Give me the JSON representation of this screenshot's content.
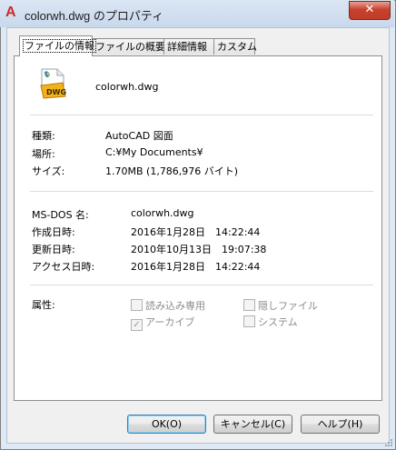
{
  "window": {
    "title": "colorwh.dwg のプロパティ",
    "close_glyph": "✕",
    "app_icon_letter": "A"
  },
  "tabs": [
    {
      "label": "ファイルの情報"
    },
    {
      "label": "ファイルの概要"
    },
    {
      "label": "詳細情報"
    },
    {
      "label": "カスタム"
    }
  ],
  "file": {
    "name": "colorwh.dwg",
    "icon": "dwg-file-icon",
    "icon_text": "DWG"
  },
  "info1": [
    {
      "label": "種類:",
      "value": "AutoCAD 図面"
    },
    {
      "label": "場所:",
      "value": "C:¥My Documents¥"
    },
    {
      "label": "サイズ:",
      "value": "1.70MB (1,786,976 バイト)"
    }
  ],
  "info2": [
    {
      "label": "MS-DOS 名:",
      "value": "colorwh.dwg"
    },
    {
      "label": "作成日時:",
      "value": "2016年1月28日　14:22:44"
    },
    {
      "label": "更新日時:",
      "value": "2010年10月13日　19:07:38"
    },
    {
      "label": "アクセス日時:",
      "value": "2016年1月28日　14:22:44"
    }
  ],
  "attributes": {
    "label": "属性:",
    "readonly": {
      "label": "読み込み専用",
      "checked": false
    },
    "hidden": {
      "label": "隠しファイル",
      "checked": false
    },
    "archive": {
      "label": "アーカイブ",
      "checked": true
    },
    "system": {
      "label": "システム",
      "checked": false
    }
  },
  "buttons": {
    "ok": "OK(O)",
    "cancel": "キャンセル(C)",
    "help": "ヘルプ(H)"
  },
  "colors": {
    "title_bg": "#c8d8ec",
    "close_red": "#c7412f",
    "accent": "#3c7fb1"
  }
}
